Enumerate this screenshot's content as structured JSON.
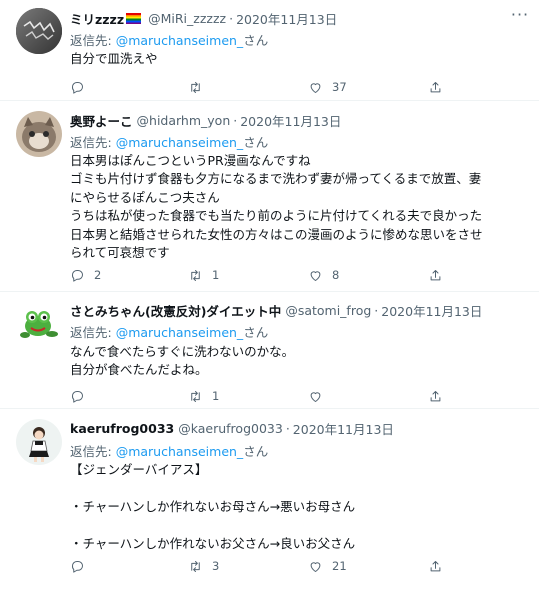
{
  "tweets": [
    {
      "name": "ミリzzzz",
      "handle": "@MiRi_zzzzz",
      "date": "2020年11月13日",
      "reply_prefix": "返信先: ",
      "reply_to": "@maruchanseimen_",
      "reply_suffix": "さん",
      "text_lines": [
        "自分で皿洗えや"
      ],
      "replies": "",
      "retweets": "",
      "likes": "37",
      "icons": [
        "reply-icon",
        "retweet-icon",
        "like-icon",
        "share-icon"
      ]
    },
    {
      "name": "奥野よーこ",
      "handle": "@hidarhm_yon",
      "date": "2020年11月13日",
      "reply_prefix": "返信先: ",
      "reply_to": "@maruchanseimen_",
      "reply_suffix": "さん",
      "text_lines": [
        "日本男はぽんこつというPR漫画なんですね",
        "ゴミも片付けず食器も夕方になるまで洗わず妻が帰ってくるまで放置、妻",
        "にやらせるぽんこつ夫さん",
        "うちは私が使った食器でも当たり前のように片付けてくれる夫で良かった",
        "日本男と結婚させられた女性の方々はこの漫画のように惨めな思いをさせ",
        "られて可哀想です"
      ],
      "replies": "2",
      "retweets": "1",
      "likes": "8"
    },
    {
      "name": "さとみちゃん(改憲反対)ダイエット中",
      "handle": "@satomi_frog",
      "date": "2020年11月13日",
      "reply_prefix": "返信先: ",
      "reply_to": "@maruchanseimen_",
      "reply_suffix": "さん",
      "text_lines": [
        "なんで食べたらすぐに洗わないのかな。",
        "自分が食べたんだよね。"
      ],
      "replies": "",
      "retweets": "1",
      "likes": ""
    },
    {
      "name": "kaerufrog0033",
      "handle": "@kaerufrog0033",
      "date": "2020年11月13日",
      "reply_prefix": "返信先: ",
      "reply_to": "@maruchanseimen_",
      "reply_suffix": "さん",
      "text_lines": [
        "【ジェンダーバイアス】",
        "",
        "・チャーハンしか作れないお母さん→悪いお母さん",
        "",
        "・チャーハンしか作れないお父さん→良いお父さん"
      ],
      "replies": "",
      "retweets": "3",
      "likes": "21"
    }
  ],
  "more_icon": "more-icon",
  "colors": {
    "link": "#1d9bf0",
    "muted": "#536471",
    "text": "#0f1419",
    "divider": "#eff3f4"
  }
}
